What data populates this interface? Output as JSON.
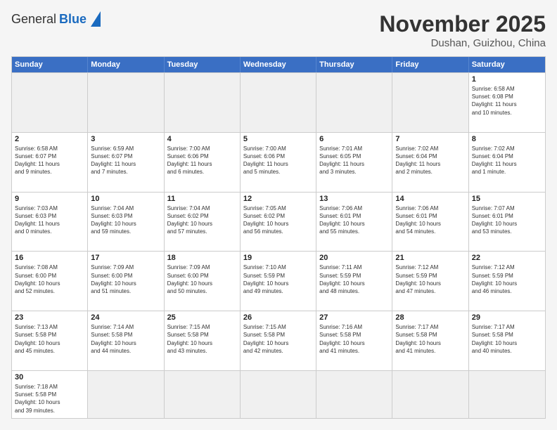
{
  "header": {
    "logo_general": "General",
    "logo_blue": "Blue",
    "month_title": "November 2025",
    "location": "Dushan, Guizhou, China"
  },
  "weekdays": [
    "Sunday",
    "Monday",
    "Tuesday",
    "Wednesday",
    "Thursday",
    "Friday",
    "Saturday"
  ],
  "weeks": [
    [
      {
        "day": "",
        "info": ""
      },
      {
        "day": "",
        "info": ""
      },
      {
        "day": "",
        "info": ""
      },
      {
        "day": "",
        "info": ""
      },
      {
        "day": "",
        "info": ""
      },
      {
        "day": "",
        "info": ""
      },
      {
        "day": "1",
        "info": "Sunrise: 6:58 AM\nSunset: 6:08 PM\nDaylight: 11 hours\nand 10 minutes."
      }
    ],
    [
      {
        "day": "2",
        "info": "Sunrise: 6:58 AM\nSunset: 6:07 PM\nDaylight: 11 hours\nand 9 minutes."
      },
      {
        "day": "3",
        "info": "Sunrise: 6:59 AM\nSunset: 6:07 PM\nDaylight: 11 hours\nand 7 minutes."
      },
      {
        "day": "4",
        "info": "Sunrise: 7:00 AM\nSunset: 6:06 PM\nDaylight: 11 hours\nand 6 minutes."
      },
      {
        "day": "5",
        "info": "Sunrise: 7:00 AM\nSunset: 6:06 PM\nDaylight: 11 hours\nand 5 minutes."
      },
      {
        "day": "6",
        "info": "Sunrise: 7:01 AM\nSunset: 6:05 PM\nDaylight: 11 hours\nand 3 minutes."
      },
      {
        "day": "7",
        "info": "Sunrise: 7:02 AM\nSunset: 6:04 PM\nDaylight: 11 hours\nand 2 minutes."
      },
      {
        "day": "8",
        "info": "Sunrise: 7:02 AM\nSunset: 6:04 PM\nDaylight: 11 hours\nand 1 minute."
      }
    ],
    [
      {
        "day": "9",
        "info": "Sunrise: 7:03 AM\nSunset: 6:03 PM\nDaylight: 11 hours\nand 0 minutes."
      },
      {
        "day": "10",
        "info": "Sunrise: 7:04 AM\nSunset: 6:03 PM\nDaylight: 10 hours\nand 59 minutes."
      },
      {
        "day": "11",
        "info": "Sunrise: 7:04 AM\nSunset: 6:02 PM\nDaylight: 10 hours\nand 57 minutes."
      },
      {
        "day": "12",
        "info": "Sunrise: 7:05 AM\nSunset: 6:02 PM\nDaylight: 10 hours\nand 56 minutes."
      },
      {
        "day": "13",
        "info": "Sunrise: 7:06 AM\nSunset: 6:01 PM\nDaylight: 10 hours\nand 55 minutes."
      },
      {
        "day": "14",
        "info": "Sunrise: 7:06 AM\nSunset: 6:01 PM\nDaylight: 10 hours\nand 54 minutes."
      },
      {
        "day": "15",
        "info": "Sunrise: 7:07 AM\nSunset: 6:01 PM\nDaylight: 10 hours\nand 53 minutes."
      }
    ],
    [
      {
        "day": "16",
        "info": "Sunrise: 7:08 AM\nSunset: 6:00 PM\nDaylight: 10 hours\nand 52 minutes."
      },
      {
        "day": "17",
        "info": "Sunrise: 7:09 AM\nSunset: 6:00 PM\nDaylight: 10 hours\nand 51 minutes."
      },
      {
        "day": "18",
        "info": "Sunrise: 7:09 AM\nSunset: 6:00 PM\nDaylight: 10 hours\nand 50 minutes."
      },
      {
        "day": "19",
        "info": "Sunrise: 7:10 AM\nSunset: 5:59 PM\nDaylight: 10 hours\nand 49 minutes."
      },
      {
        "day": "20",
        "info": "Sunrise: 7:11 AM\nSunset: 5:59 PM\nDaylight: 10 hours\nand 48 minutes."
      },
      {
        "day": "21",
        "info": "Sunrise: 7:12 AM\nSunset: 5:59 PM\nDaylight: 10 hours\nand 47 minutes."
      },
      {
        "day": "22",
        "info": "Sunrise: 7:12 AM\nSunset: 5:59 PM\nDaylight: 10 hours\nand 46 minutes."
      }
    ],
    [
      {
        "day": "23",
        "info": "Sunrise: 7:13 AM\nSunset: 5:58 PM\nDaylight: 10 hours\nand 45 minutes."
      },
      {
        "day": "24",
        "info": "Sunrise: 7:14 AM\nSunset: 5:58 PM\nDaylight: 10 hours\nand 44 minutes."
      },
      {
        "day": "25",
        "info": "Sunrise: 7:15 AM\nSunset: 5:58 PM\nDaylight: 10 hours\nand 43 minutes."
      },
      {
        "day": "26",
        "info": "Sunrise: 7:15 AM\nSunset: 5:58 PM\nDaylight: 10 hours\nand 42 minutes."
      },
      {
        "day": "27",
        "info": "Sunrise: 7:16 AM\nSunset: 5:58 PM\nDaylight: 10 hours\nand 41 minutes."
      },
      {
        "day": "28",
        "info": "Sunrise: 7:17 AM\nSunset: 5:58 PM\nDaylight: 10 hours\nand 41 minutes."
      },
      {
        "day": "29",
        "info": "Sunrise: 7:17 AM\nSunset: 5:58 PM\nDaylight: 10 hours\nand 40 minutes."
      }
    ],
    [
      {
        "day": "30",
        "info": "Sunrise: 7:18 AM\nSunset: 5:58 PM\nDaylight: 10 hours\nand 39 minutes."
      },
      {
        "day": "",
        "info": ""
      },
      {
        "day": "",
        "info": ""
      },
      {
        "day": "",
        "info": ""
      },
      {
        "day": "",
        "info": ""
      },
      {
        "day": "",
        "info": ""
      },
      {
        "day": "",
        "info": ""
      }
    ]
  ]
}
